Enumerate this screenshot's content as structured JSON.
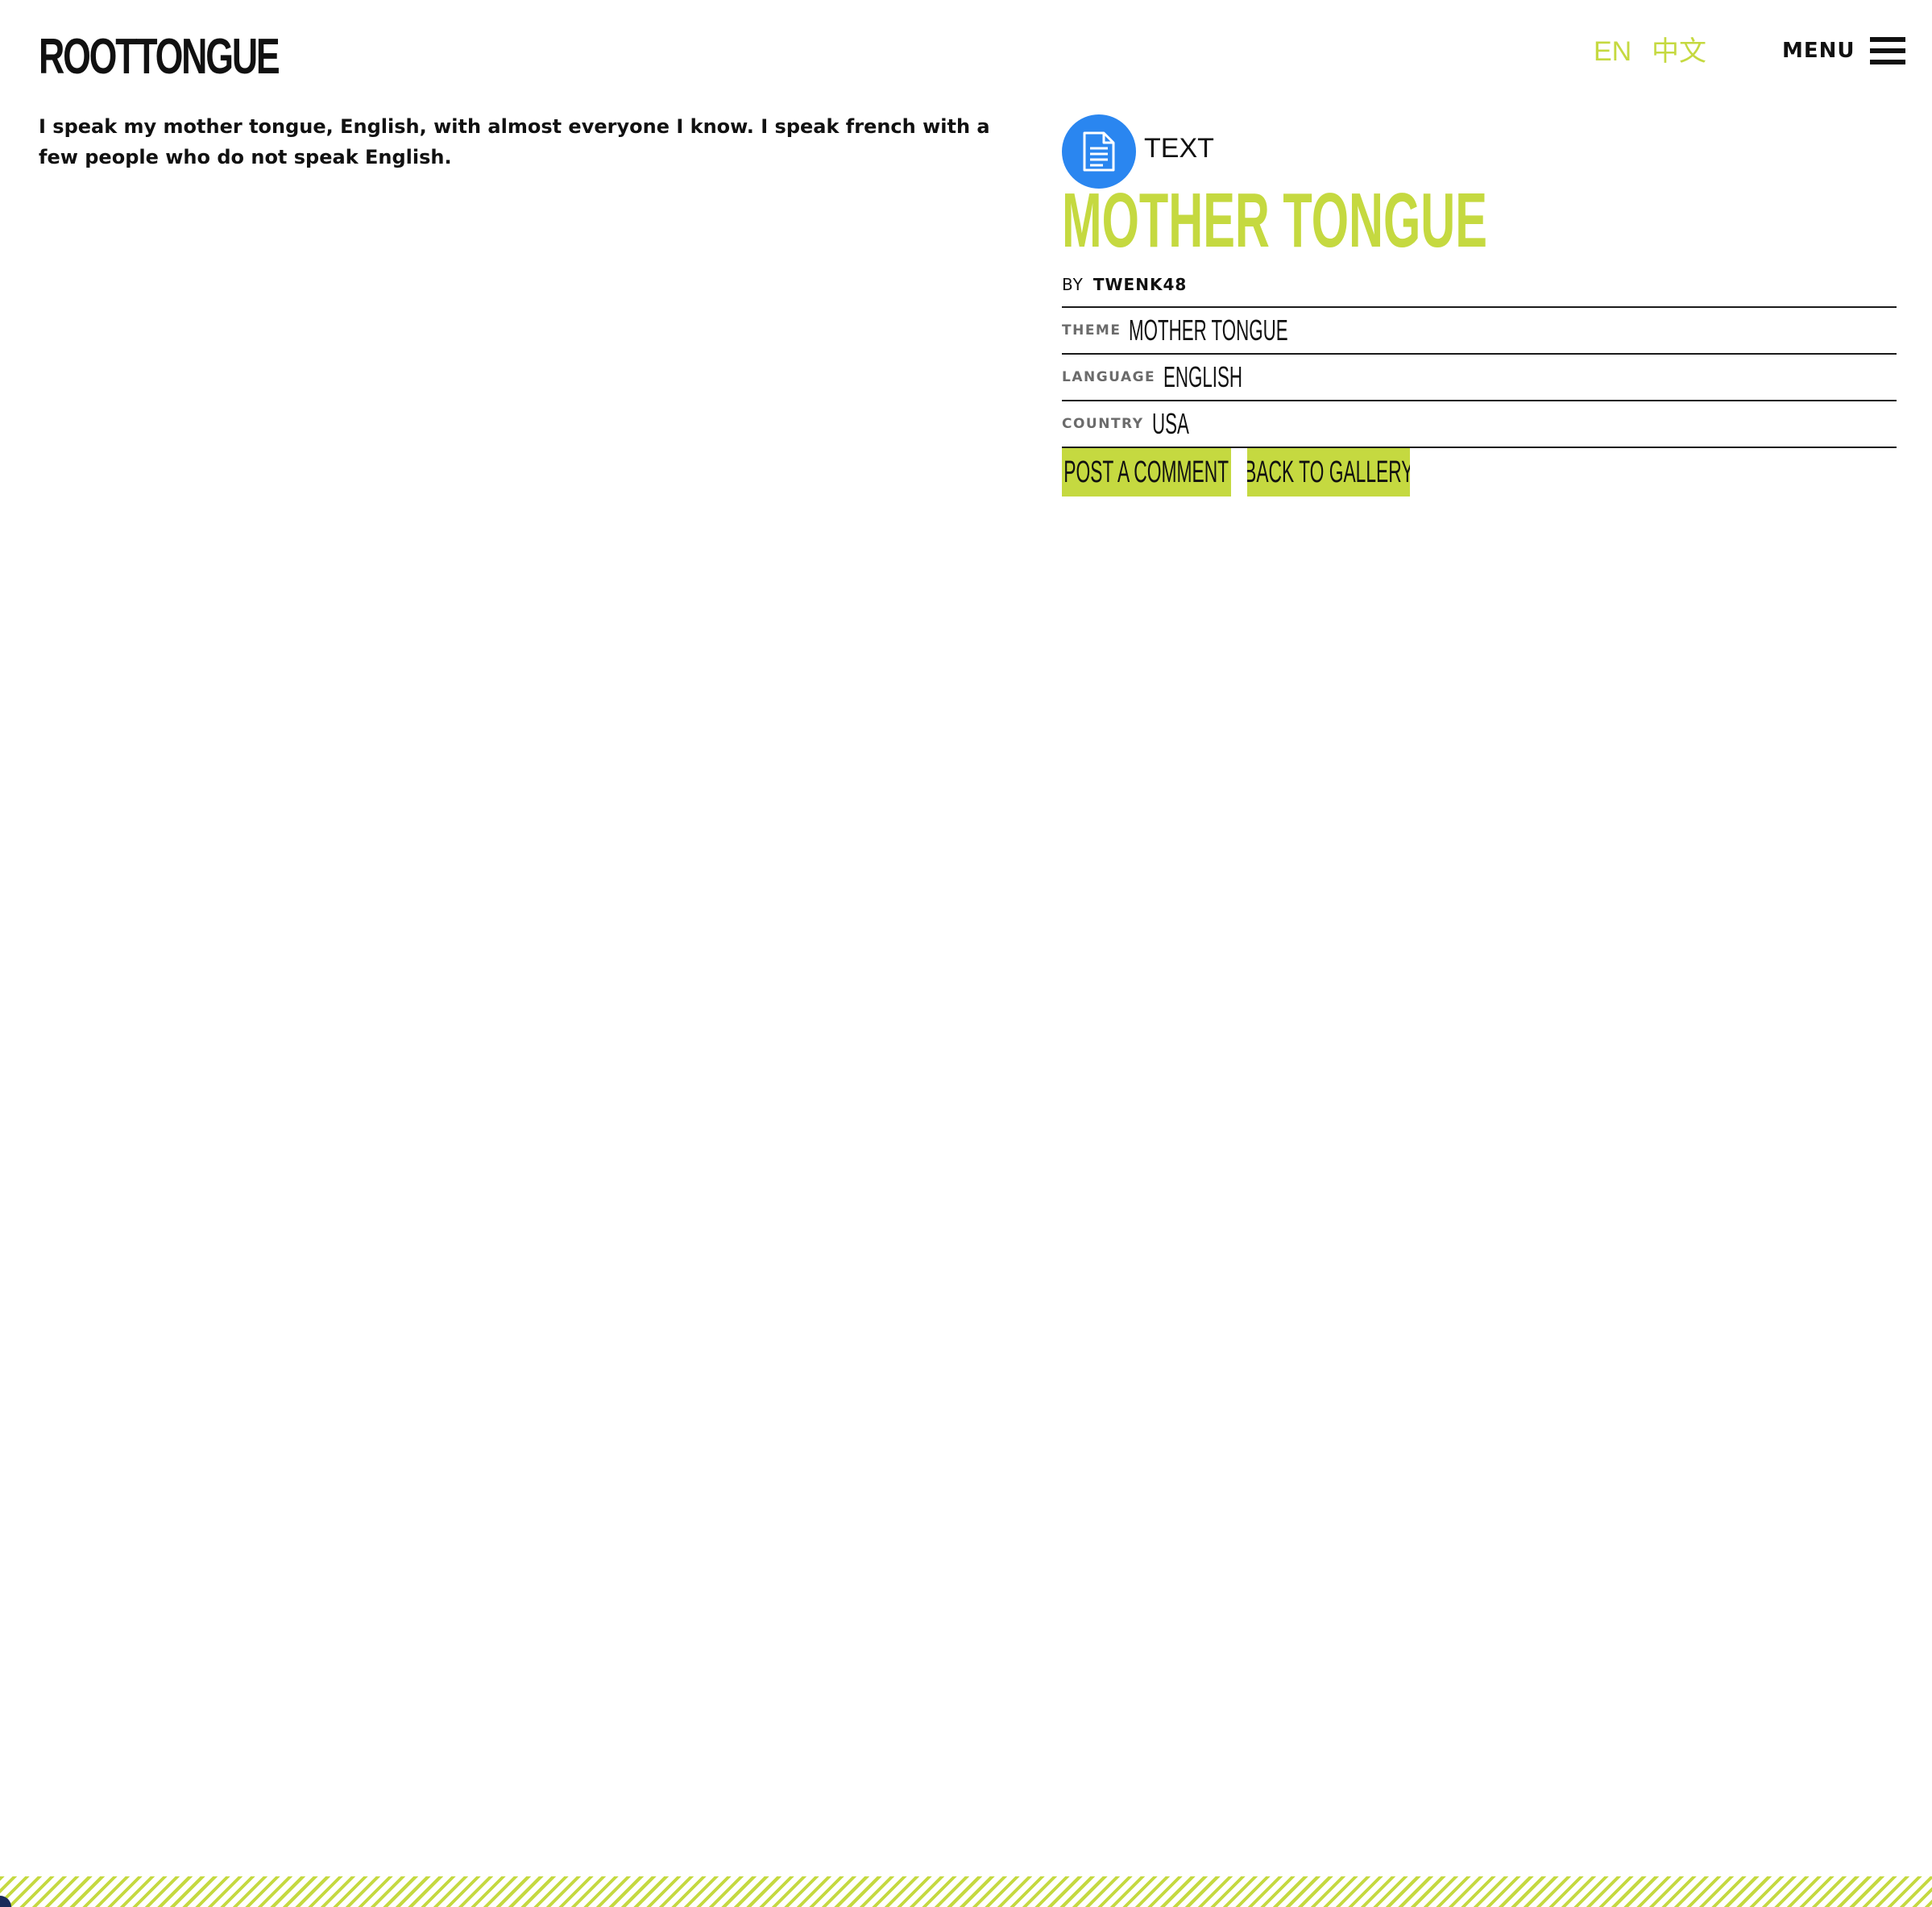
{
  "header": {
    "logo_text": "ROOTTONGUE",
    "languages": [
      "EN",
      "中文"
    ],
    "menu_label": "MENU"
  },
  "post": {
    "body": "I speak my mother tongue, English, with almost everyone I know. I speak french with a few people who do not speak English.",
    "type_label": "TEXT",
    "type_icon": "document-icon",
    "title": "MOTHER TONGUE",
    "by_prefix": "BY",
    "author": "TWENK48",
    "meta": [
      {
        "key": "THEME",
        "value": "MOTHER TONGUE"
      },
      {
        "key": "LANGUAGE",
        "value": "ENGLISH"
      },
      {
        "key": "COUNTRY",
        "value": "USA"
      }
    ]
  },
  "actions": {
    "post_comment": "POST A COMMENT",
    "back_to_gallery": "BACK TO GALLERY"
  },
  "colors": {
    "accent": "#c5d940",
    "type_badge": "#2a86f0",
    "text": "#111111",
    "meta_key": "#6b6b6b"
  }
}
